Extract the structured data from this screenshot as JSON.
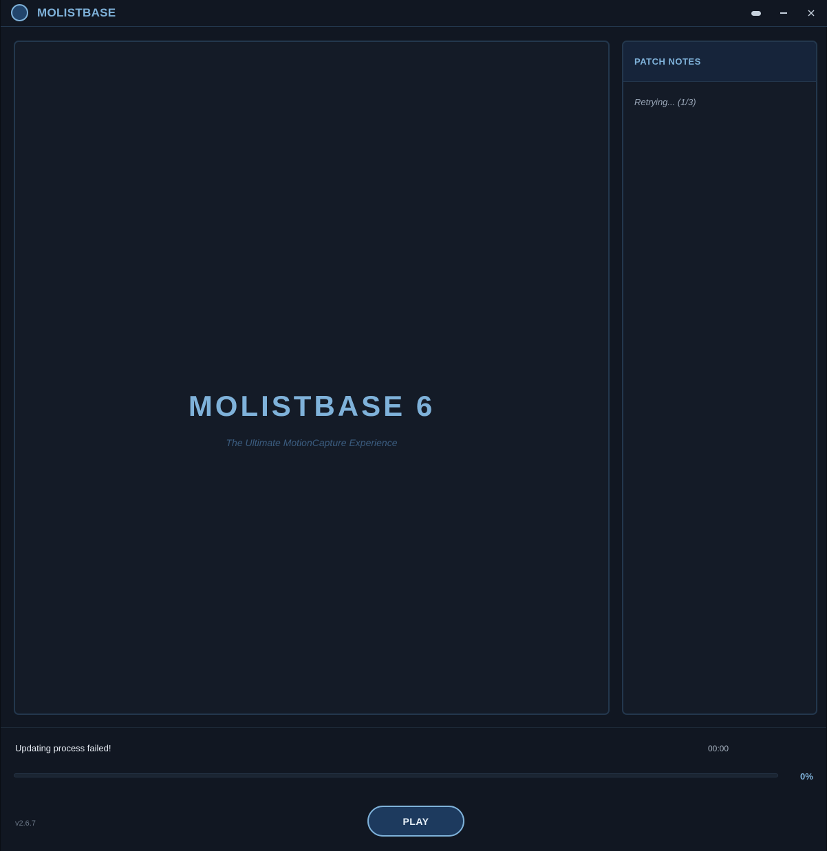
{
  "app": {
    "title": "MOLISTBASE",
    "logo_icon": "app-logo-circle"
  },
  "window_controls": {
    "pill_icon": "pill-icon",
    "minimize_icon": "minimize-icon",
    "close_icon": "close-icon"
  },
  "hero": {
    "title": "MOLISTBASE 6",
    "subtitle": "The Ultimate MotionCapture Experience"
  },
  "patch_notes": {
    "title": "PATCH NOTES",
    "content": "Retrying... (1/3)"
  },
  "footer": {
    "status": "Updating process failed!",
    "timer": "00:00",
    "progress_percent": 0,
    "progress_label": "0%",
    "version": "v2.6.7",
    "play_label": "PLAY"
  },
  "colors": {
    "accent": "#7fb2da",
    "background": "#111722",
    "panel": "#141b27",
    "border": "#23374d",
    "button_fill": "#1d3a5e"
  }
}
